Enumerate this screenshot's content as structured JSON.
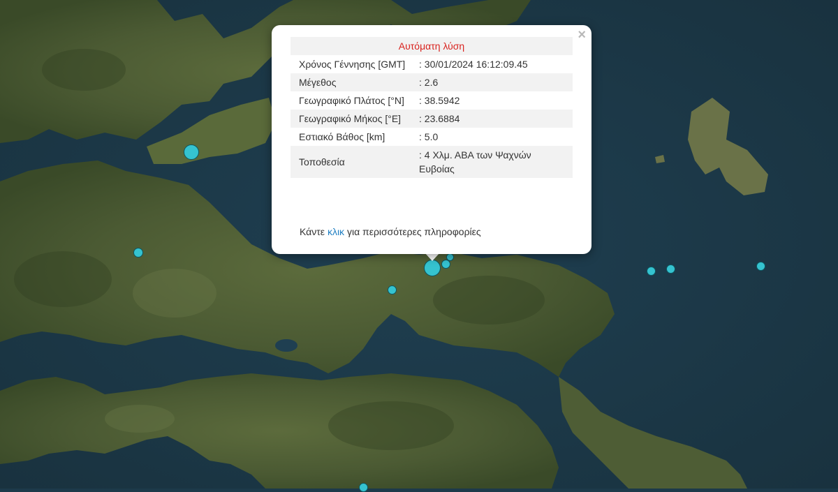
{
  "popup": {
    "header": "Αυτόματη λύση",
    "close_symbol": "×",
    "rows": [
      {
        "label": "Χρόνος Γέννησης [GMT]",
        "value": ": 30/01/2024 16:12:09.45"
      },
      {
        "label": "Μέγεθος",
        "value": ": 2.6"
      },
      {
        "label": "Γεωγραφικό Πλάτος [°N]",
        "value": ": 38.5942"
      },
      {
        "label": "Γεωγραφικό Μήκος [°E]",
        "value": ": 23.6884"
      },
      {
        "label": "Εστιακό Βάθος [km]",
        "value": ": 5.0"
      },
      {
        "label": "Τοποθεσία",
        "value": ": 4 Χλμ. ΑΒΑ των Ψαχνών Ευβοίας"
      }
    ],
    "more_prefix": "Κάντε",
    "more_link": "κλικ",
    "more_suffix": "για περισσότερες πληροφορίες"
  },
  "colors": {
    "sea": "#1d3a4a",
    "land": "#4a5a32",
    "marker": "#35c3d0",
    "header_text": "#d9231f",
    "link": "#2280c3"
  }
}
